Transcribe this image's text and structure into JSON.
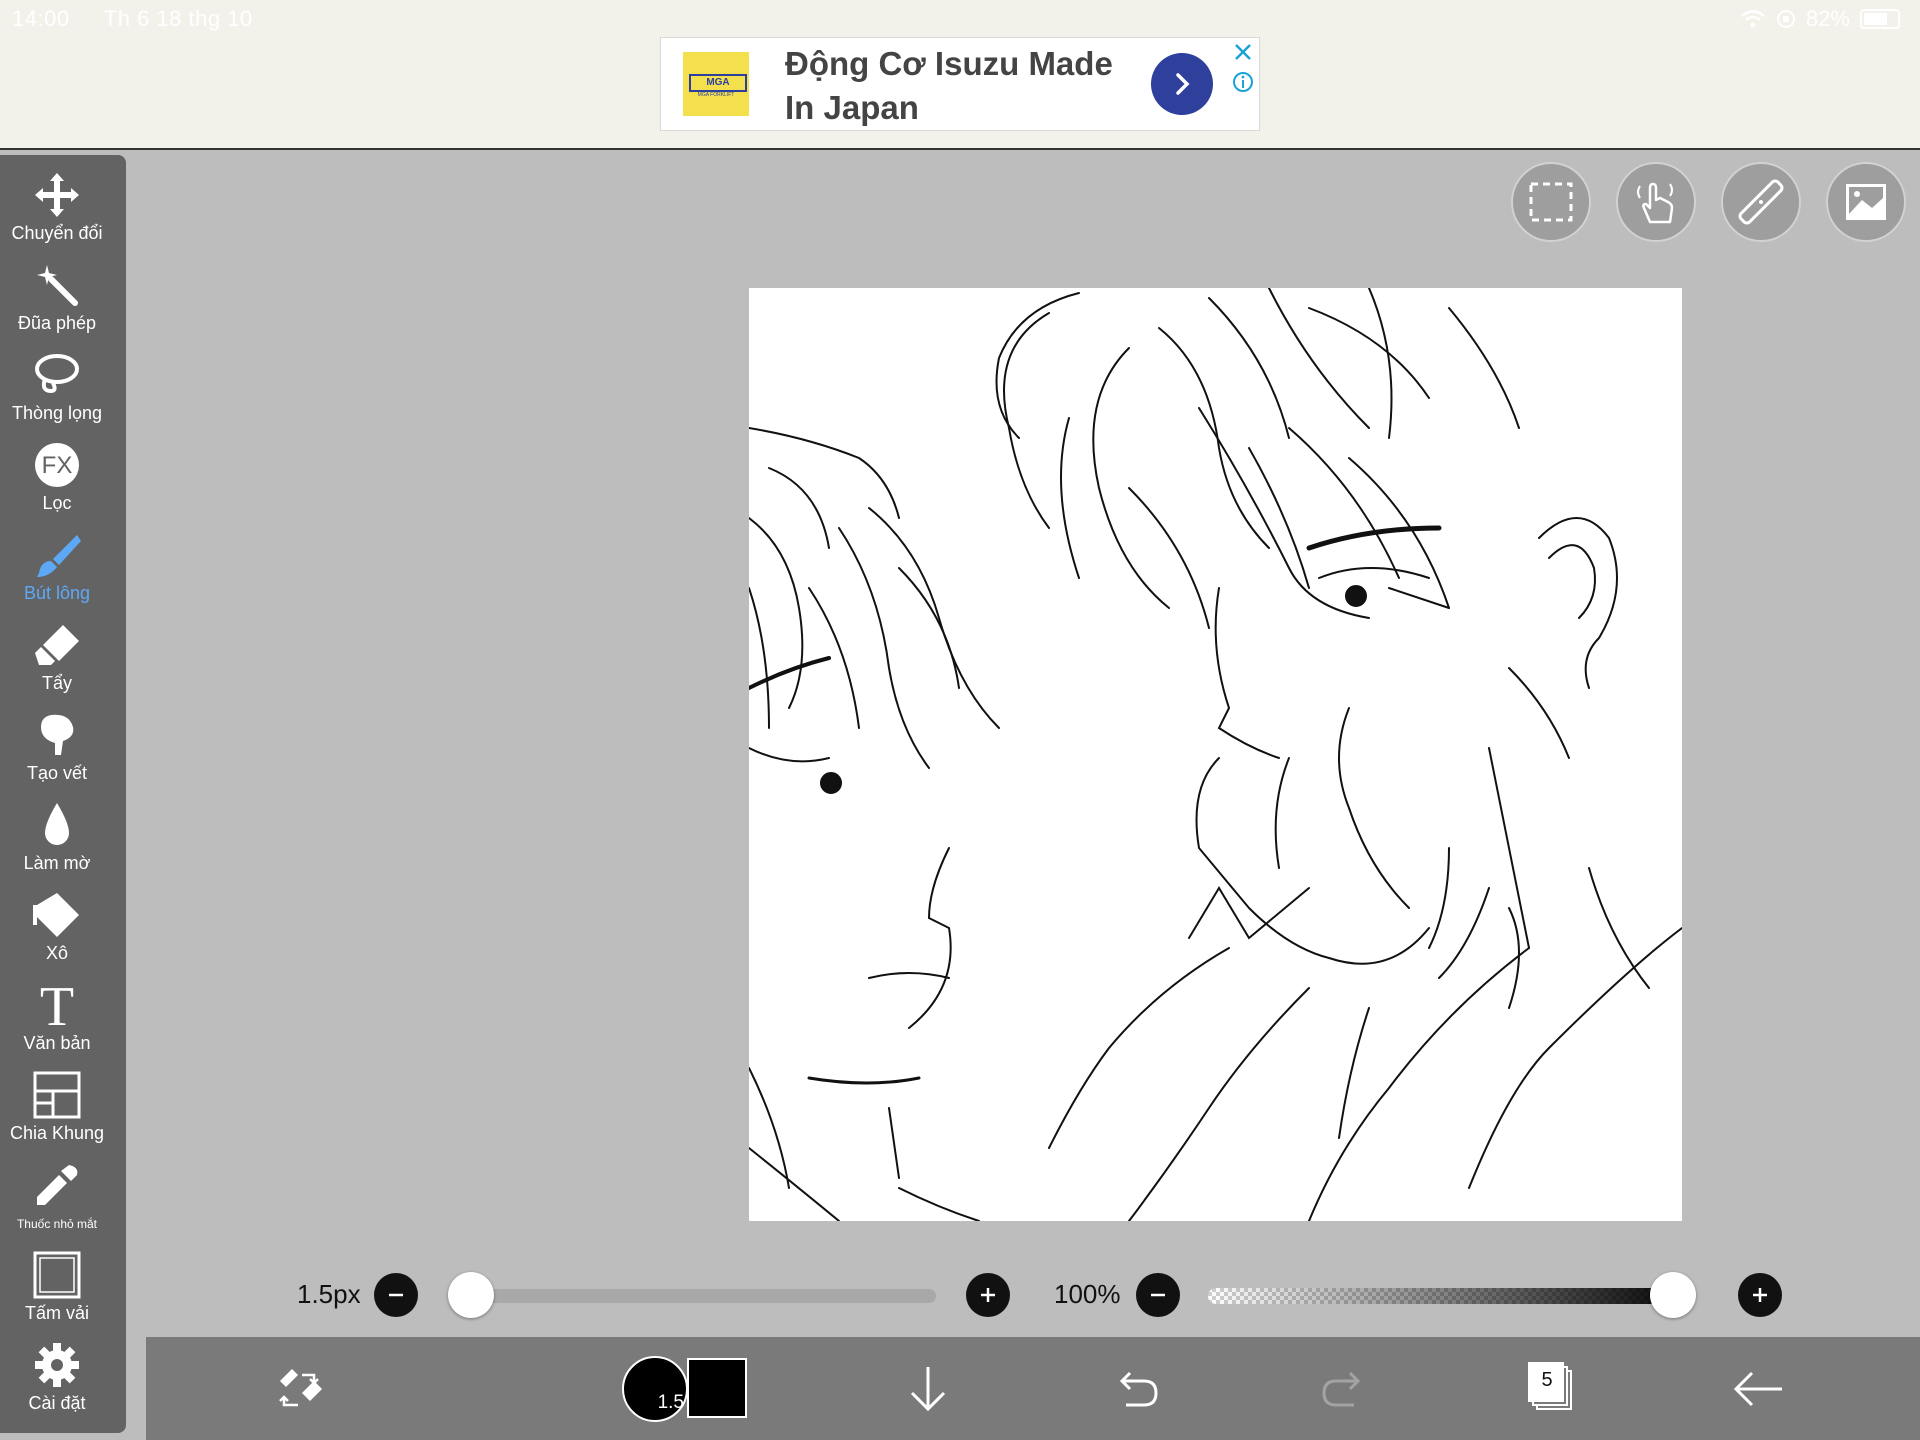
{
  "status_bar": {
    "time": "14:00",
    "date": "Th 6 18 thg 10",
    "battery_percent": "82%",
    "battery_level": 0.82
  },
  "ad": {
    "logo_text": "MGA",
    "logo_subtext": "MGA FORKLIFT",
    "title": "Động Cơ Isuzu Made In Japan",
    "go_icon": "chevron-right-icon",
    "close_icon": "close-icon",
    "info_icon": "info-icon"
  },
  "tools": [
    {
      "label": "Chuyển đổi",
      "icon": "move-icon"
    },
    {
      "label": "Đũa phép",
      "icon": "magic-wand-icon"
    },
    {
      "label": "Thòng lọng",
      "icon": "lasso-icon"
    },
    {
      "label": "Lọc",
      "icon": "fx-filter-icon",
      "icon_text": "FX"
    },
    {
      "label": "Bút lông",
      "icon": "brush-icon",
      "active": true
    },
    {
      "label": "Tẩy",
      "icon": "eraser-icon"
    },
    {
      "label": "Tạo vết",
      "icon": "smudge-icon"
    },
    {
      "label": "Làm mờ",
      "icon": "blur-drop-icon"
    },
    {
      "label": "Xô",
      "icon": "bucket-icon"
    },
    {
      "label": "Văn bản",
      "icon": "text-icon",
      "icon_text": "T"
    },
    {
      "label": "Chia Khung",
      "icon": "frame-divider-icon"
    },
    {
      "label": "Thuốc nhỏ mắt",
      "icon": "eyedropper-icon"
    },
    {
      "label": "Tấm vải",
      "icon": "canvas-icon"
    },
    {
      "label": "Cài đặt",
      "icon": "gear-icon"
    }
  ],
  "floating_buttons": [
    "selection-icon",
    "gesture-hand-icon",
    "ruler-icon",
    "image-icon"
  ],
  "brush": {
    "size_label": "1.5px",
    "size_value": 1.5,
    "size_fraction": 0.0,
    "opacity_label": "100%",
    "opacity_fraction": 1.0
  },
  "bottom_bar": {
    "brush_size_badge": "1.5",
    "color": "#000000",
    "layer_count": "5",
    "icons": [
      "swap-tools-icon",
      "brush-size-icon",
      "color-swatch-icon",
      "arrow-down-icon",
      "undo-icon",
      "redo-icon",
      "layers-icon",
      "back-arrow-icon"
    ]
  },
  "colors": {
    "accent": "#5da8f5",
    "panel": "#636363",
    "workspace": "#bdbdbd",
    "ad_button": "#2e3f9c"
  }
}
